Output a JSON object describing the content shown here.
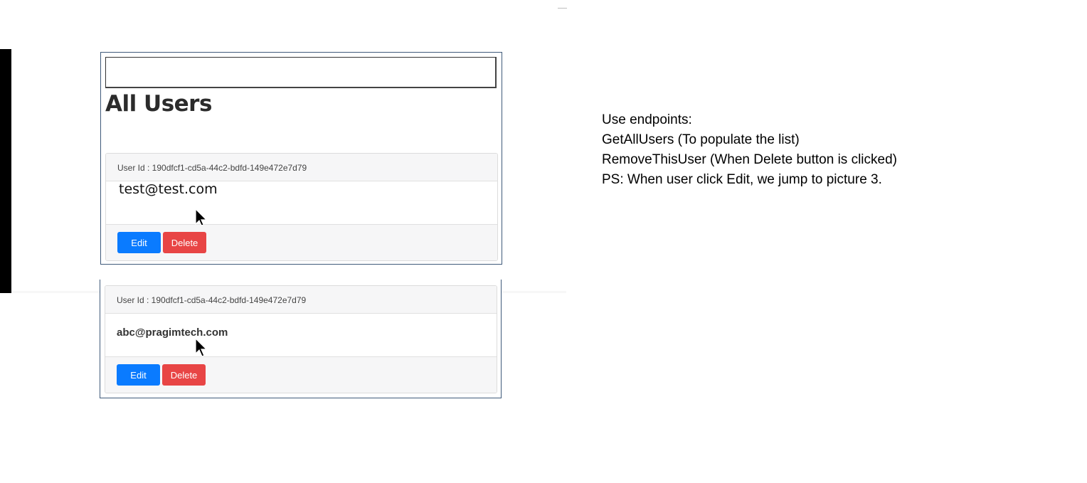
{
  "screenshot1": {
    "title": "All Users",
    "search_value": "",
    "card": {
      "user_id": "User Id : 190dfcf1-cd5a-44c2-bdfd-149e472e7d79",
      "email": "test@test.com",
      "edit_label": "Edit",
      "delete_label": "Delete"
    }
  },
  "screenshot2": {
    "card": {
      "user_id": "User Id : 190dfcf1-cd5a-44c2-bdfd-149e472e7d79",
      "email": "abc@pragimtech.com",
      "edit_label": "Edit",
      "delete_label": "Delete"
    }
  },
  "notes": {
    "line1": "Use endpoints:",
    "line2": "GetAllUsers (To populate the list)",
    "line3": "RemoveThisUser (When Delete button is clicked)",
    "line4": "PS: When user click Edit, we jump to picture 3."
  },
  "colors": {
    "edit_button": "#0a7bff",
    "delete_button": "#e84545",
    "card_header_bg": "#f6f6f7"
  },
  "icons": [
    "mouse-cursor-icon"
  ]
}
